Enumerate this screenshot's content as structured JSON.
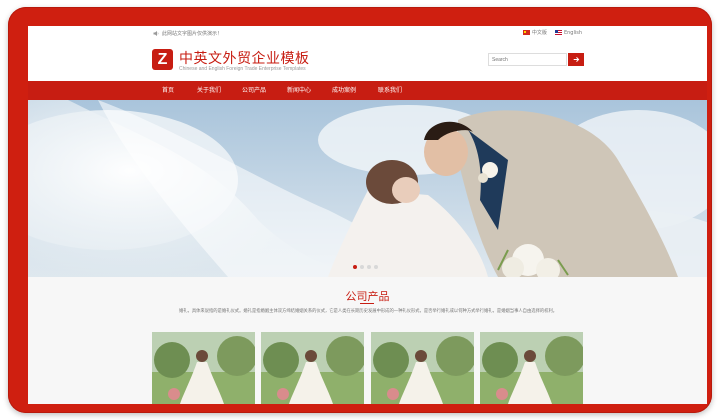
{
  "topbar": {
    "notice": "此网站文字图片仅供演示！",
    "lang_cn": "中文版",
    "lang_en": "English"
  },
  "header": {
    "logo_letter": "Z",
    "title": "中英文外贸企业模板",
    "subtitle": "Chinese and English Foreign Trade Enterprise Templates",
    "search_placeholder": "Search"
  },
  "nav": {
    "items": [
      {
        "label": "首页"
      },
      {
        "label": "关于我们"
      },
      {
        "label": "公司产品"
      },
      {
        "label": "新闻中心"
      },
      {
        "label": "成功案例"
      },
      {
        "label": "联系我们"
      }
    ]
  },
  "slider": {
    "dots": 4,
    "active": 1
  },
  "products": {
    "title": "公司产品",
    "description": "婚礼，具体来说指的是婚礼仪式。婚礼是指婚姻主体双方缔结婚姻关系的仪式，它是人类在长期历史发展中形成的一种礼仪形式，是否举行婚礼或以何种方式举行婚礼，是婚姻当事人自由选择的权利。",
    "count": 4
  },
  "colors": {
    "brand": "#c71d12",
    "frame": "#cf1f10"
  }
}
